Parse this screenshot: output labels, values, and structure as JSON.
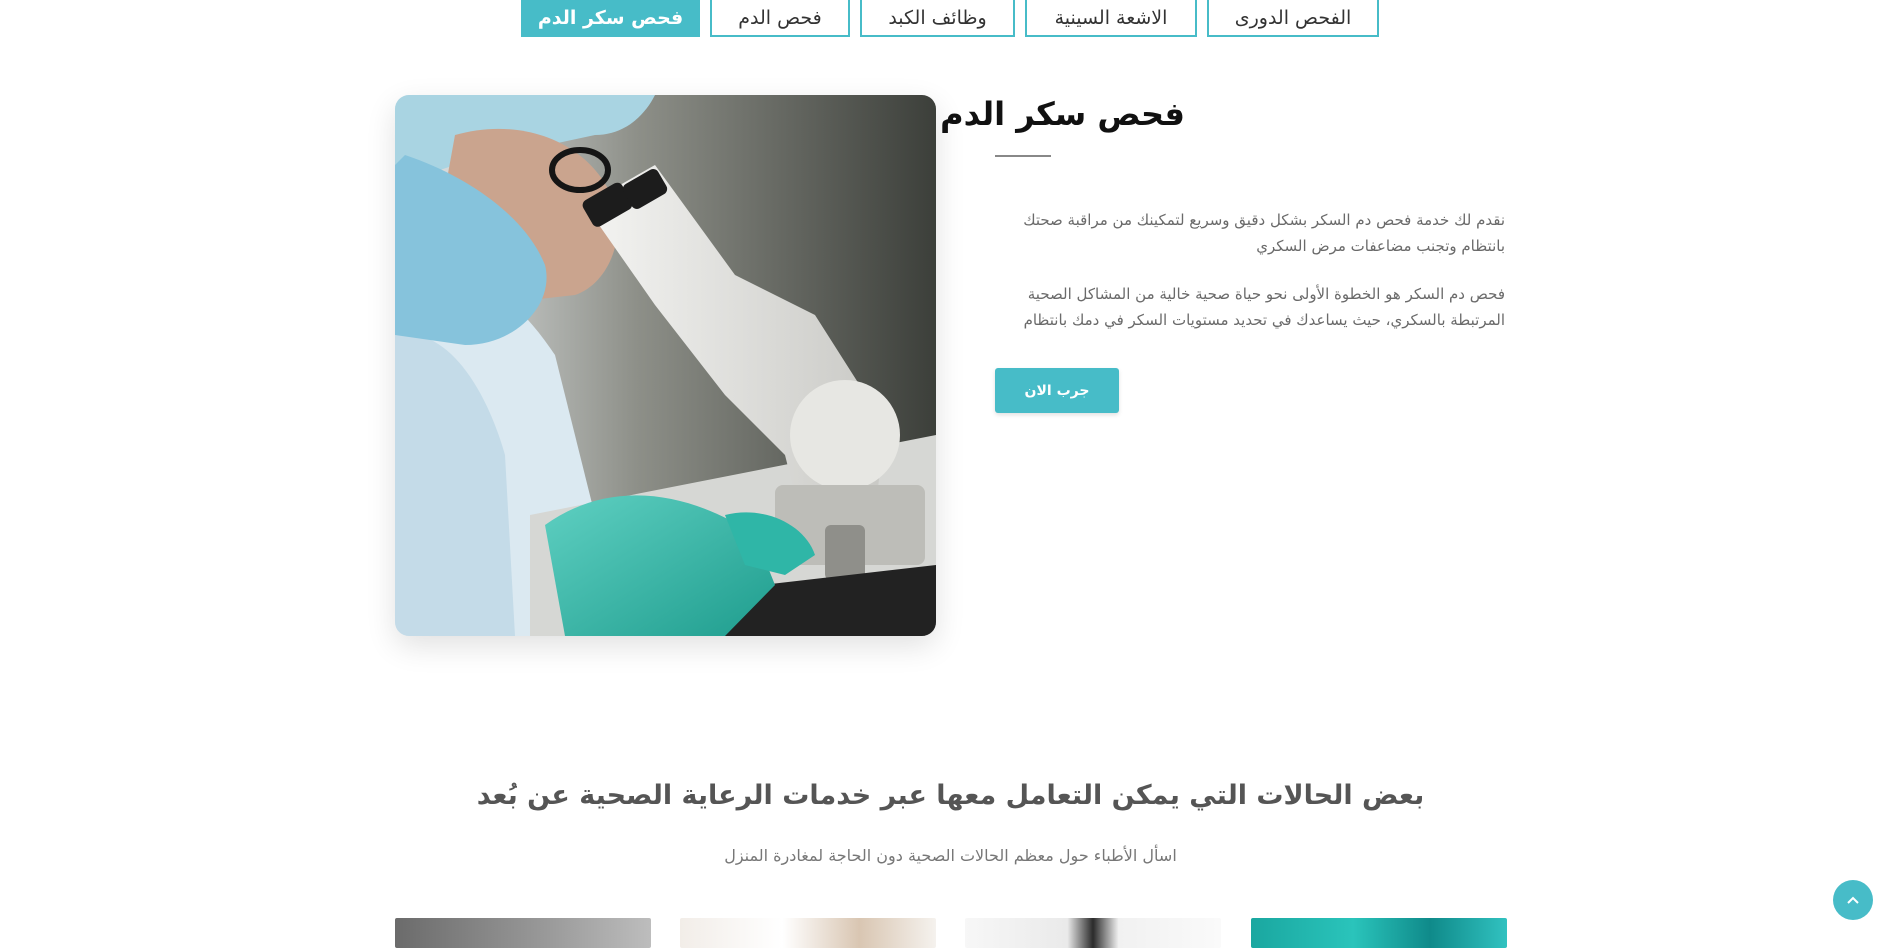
{
  "tabs": [
    {
      "label": "الفحص الدورى",
      "active": false
    },
    {
      "label": "الاشعة السينية",
      "active": false
    },
    {
      "label": "وظائف الكبد",
      "active": false
    },
    {
      "label": "فحص الدم",
      "active": false
    },
    {
      "label": "فحص سكر الدم",
      "active": true
    }
  ],
  "service": {
    "title": "فحص سكر الدم",
    "paragraph_1": "نقدم لك خدمة فحص دم السكر بشكل دقيق وسريع لتمكينك من مراقبة صحتك بانتظام وتجنب مضاعفات مرض السكري",
    "paragraph_2": "فحص دم السكر هو الخطوة الأولى نحو حياة صحية خالية من المشاكل الصحية المرتبطة بالسكري، حيث يساعدك في تحديد مستويات السكر في دمك بانتظام",
    "cta_label": "جرب الان"
  },
  "conditions": {
    "title": "بعض الحالات التي يمكن التعامل معها عبر خدمات الرعاية الصحية عن بُعد",
    "subtitle": "اسأل الأطباء حول معظم الحالات الصحية دون الحاجة لمغادرة المنزل"
  },
  "icons": {
    "back_to_top": "chevron-up-icon"
  },
  "colors": {
    "accent": "#47bcc8"
  }
}
